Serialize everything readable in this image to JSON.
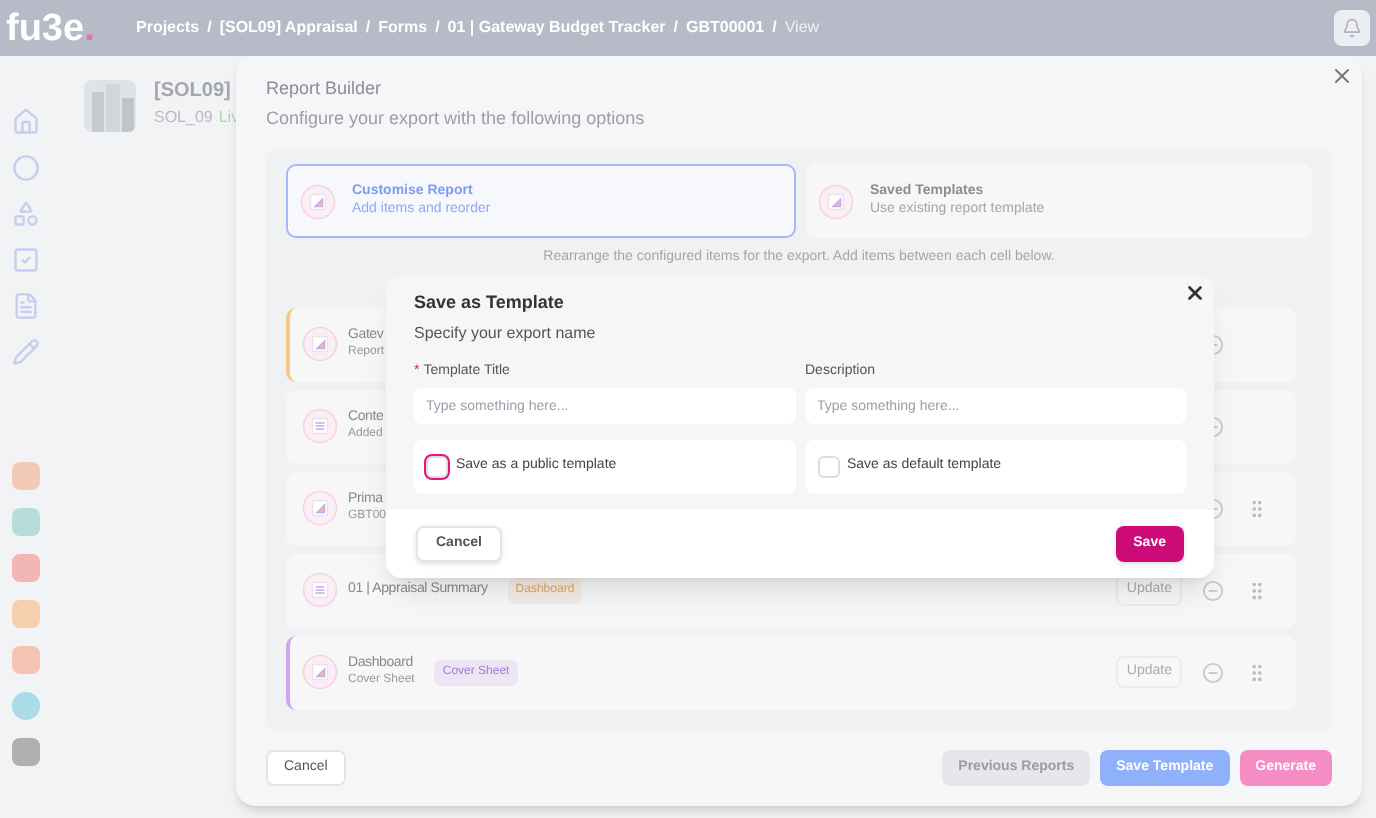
{
  "topbar": {
    "logo": {
      "text": "fu3e",
      "mark": "."
    },
    "breadcrumbs": [
      {
        "label": "Projects",
        "current": false
      },
      {
        "label": "/",
        "current": false
      },
      {
        "label": "[SOL09] Appraisal",
        "current": false
      },
      {
        "label": "/",
        "current": false
      },
      {
        "label": "Forms",
        "current": false
      },
      {
        "label": "/",
        "current": false
      },
      {
        "label": "01 | Gateway Budget Tracker",
        "current": false
      },
      {
        "label": "/",
        "current": false
      },
      {
        "label": "GBT00001",
        "current": false
      },
      {
        "label": "/",
        "current": false
      },
      {
        "label": "View",
        "current": true
      }
    ]
  },
  "project": {
    "code": "[SOL09]",
    "subtitle": "SOL_09",
    "status": "Liv"
  },
  "report_builder": {
    "title": "Report Builder",
    "subtitle": "Configure your export with the following options",
    "options": [
      {
        "title": "Customise Report",
        "subtitle": "Add items and reorder",
        "selected": true
      },
      {
        "title": "Saved Templates",
        "subtitle": "Use existing report template",
        "selected": false
      }
    ],
    "instruction": "Rearrange the configured items for the export. Add items between each cell below.",
    "items": [
      {
        "title": "Gatev",
        "subtitle": "Report",
        "color": "#f6c98a",
        "grip": false
      },
      {
        "title": "Conte",
        "subtitle": "Added",
        "grip": false
      },
      {
        "title": "Prima",
        "subtitle": "GBT00",
        "grip": true
      },
      {
        "title": "01 | Appraisal Summary",
        "tag": {
          "text": "Dashboard",
          "color": "#e0a45f"
        },
        "update": "Update",
        "grip": true
      },
      {
        "title": "Dashboard",
        "subtitle": "Cover Sheet",
        "tag": {
          "text": "Cover Sheet",
          "color": "#a77ad9"
        },
        "color": "#c9a8f0",
        "update": "Update",
        "grip": true
      }
    ],
    "buttons": [
      {
        "label": "Cancel",
        "kind": "plain"
      },
      {
        "label": "Previous Reports",
        "kind": "grey"
      },
      {
        "label": "Save Template",
        "kind": "blue"
      },
      {
        "label": "Generate",
        "kind": "pink"
      }
    ]
  },
  "dialog": {
    "title": "Save as Template",
    "subtitle": "Specify your export name",
    "fields": [
      {
        "label": "Template Title",
        "required_mark": "*",
        "placeholder": "Type something here..."
      },
      {
        "label": "Description",
        "placeholder": "Type something here..."
      }
    ],
    "checkboxes": [
      {
        "label": "Save as a public template",
        "checked": false,
        "focused": true
      },
      {
        "label": "Save as default template",
        "checked": false,
        "focused": false
      }
    ],
    "buttons": [
      {
        "label": "Cancel",
        "kind": "plain"
      },
      {
        "label": "Save",
        "kind": "primary"
      }
    ]
  }
}
